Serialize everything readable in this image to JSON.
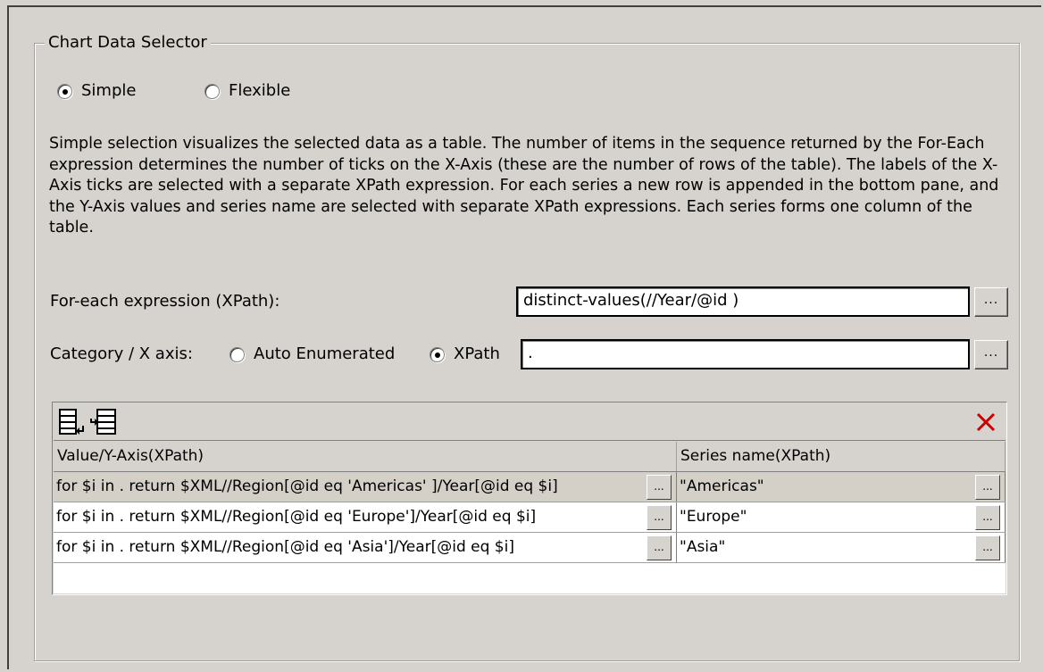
{
  "group": {
    "title": "Chart Data Selector"
  },
  "mode": {
    "simple_label": "Simple",
    "flexible_label": "Flexible",
    "selected": "Simple"
  },
  "description": "Simple selection visualizes the selected data as a table. The number of items in the sequence returned by the For-Each expression determines the number of ticks on the X-Axis (these are the number of rows of the table). The labels of the X-Axis ticks are selected with a separate XPath expression. For each series a new row is appended in the bottom pane, and the Y-Axis values and series name are selected with separate XPath expressions. Each series forms one column of the table.",
  "for_each": {
    "label": "For-each expression (XPath):",
    "value": "distinct-values(//Year/@id )",
    "button_label": "..."
  },
  "category": {
    "label": "Category / X axis:",
    "auto_label": "Auto Enumerated",
    "xpath_label": "XPath",
    "selected": "XPath",
    "value": ".",
    "button_label": "..."
  },
  "grid": {
    "toolbar": {
      "append_icon": "append-row-icon",
      "insert_icon": "insert-row-icon",
      "delete_icon": "delete-row-icon"
    },
    "headers": {
      "value": "Value/Y-Axis(XPath)",
      "series": "Series name(XPath)"
    },
    "rows": [
      {
        "value": "for $i in . return $XML//Region[@id eq 'Americas' ]/Year[@id eq $i]",
        "series": "\"Americas\"",
        "button_label": "..."
      },
      {
        "value": "for $i in . return $XML//Region[@id eq 'Europe']/Year[@id eq $i]",
        "series": "\"Europe\"",
        "button_label": "..."
      },
      {
        "value": "for $i in . return $XML//Region[@id eq 'Asia']/Year[@id eq $i]",
        "series": "\"Asia\"",
        "button_label": "..."
      }
    ],
    "selected_row": 0
  },
  "colors": {
    "background": "#d6d3ce",
    "delete_red": "#cc0000"
  }
}
